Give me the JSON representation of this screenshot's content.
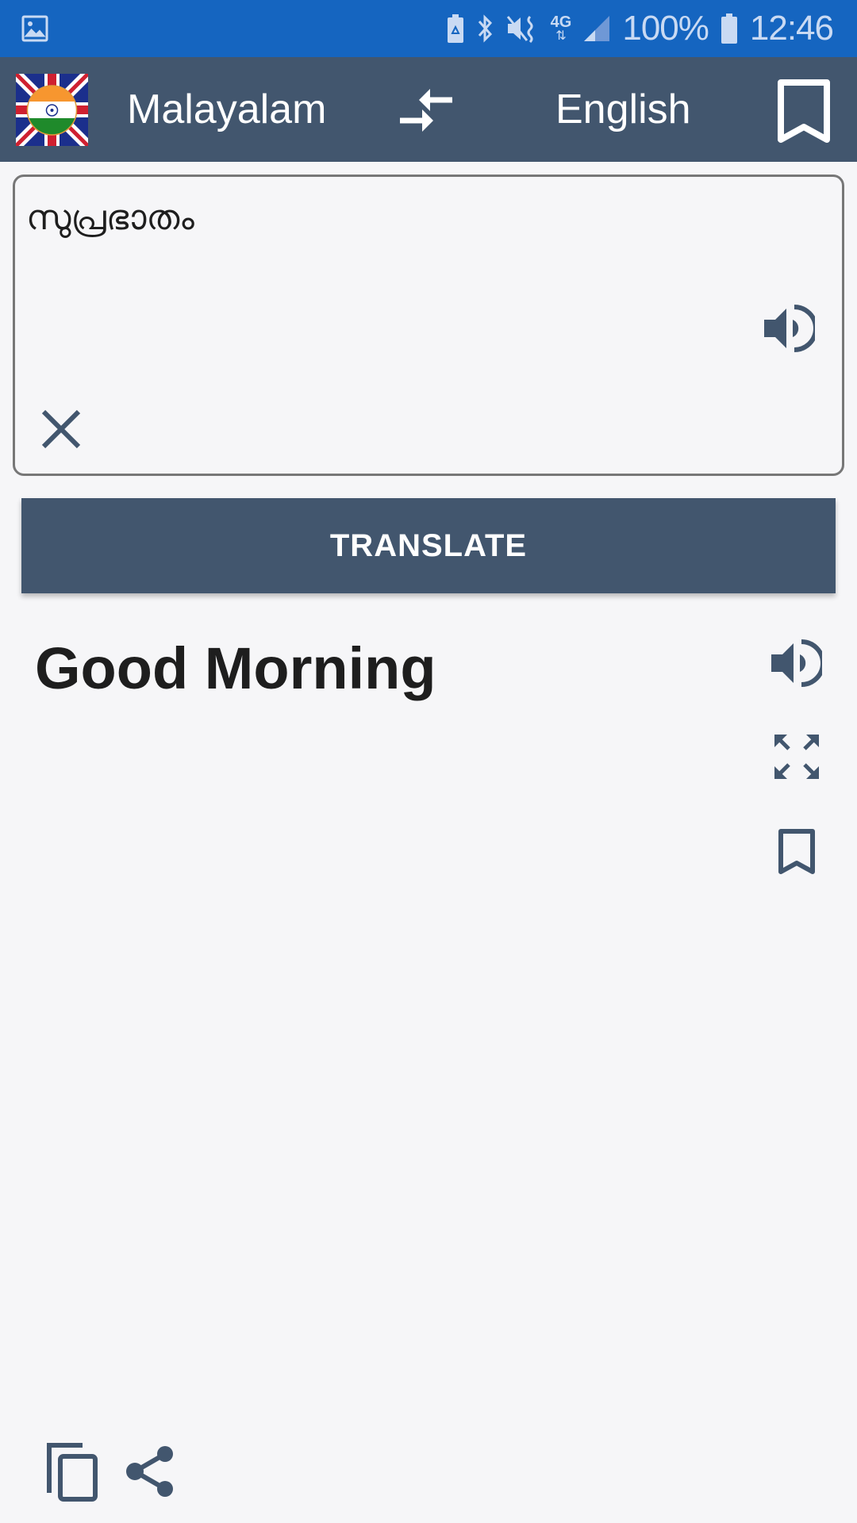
{
  "status_bar": {
    "icons": [
      "gallery-icon",
      "battery-saver-icon",
      "bluetooth-icon",
      "mute-vibrate-icon",
      "network-4g-icon",
      "signal-icon"
    ],
    "network_label": "4G",
    "battery": "100%",
    "time": "12:46"
  },
  "app_bar": {
    "flag_icon": "india-uk-flag-icon",
    "source_language": "Malayalam",
    "swap_icon": "swap-languages-icon",
    "target_language": "English",
    "bookmark_icon": "bookmark-icon"
  },
  "input": {
    "text": "സുപ്രഭാതം",
    "speak_icon": "speaker-icon",
    "clear_icon": "close-icon"
  },
  "translate_button": {
    "label": "TRANSLATE"
  },
  "output": {
    "text": "Good Morning",
    "actions": [
      "speaker-icon",
      "fullscreen-icon",
      "bookmark-icon"
    ]
  },
  "bottom_actions": [
    "copy-icon",
    "share-icon"
  ],
  "colors": {
    "status_bar": "#1565c0",
    "primary": "#42566e",
    "background": "#f6f6f8",
    "text": "#1e1e1e"
  }
}
